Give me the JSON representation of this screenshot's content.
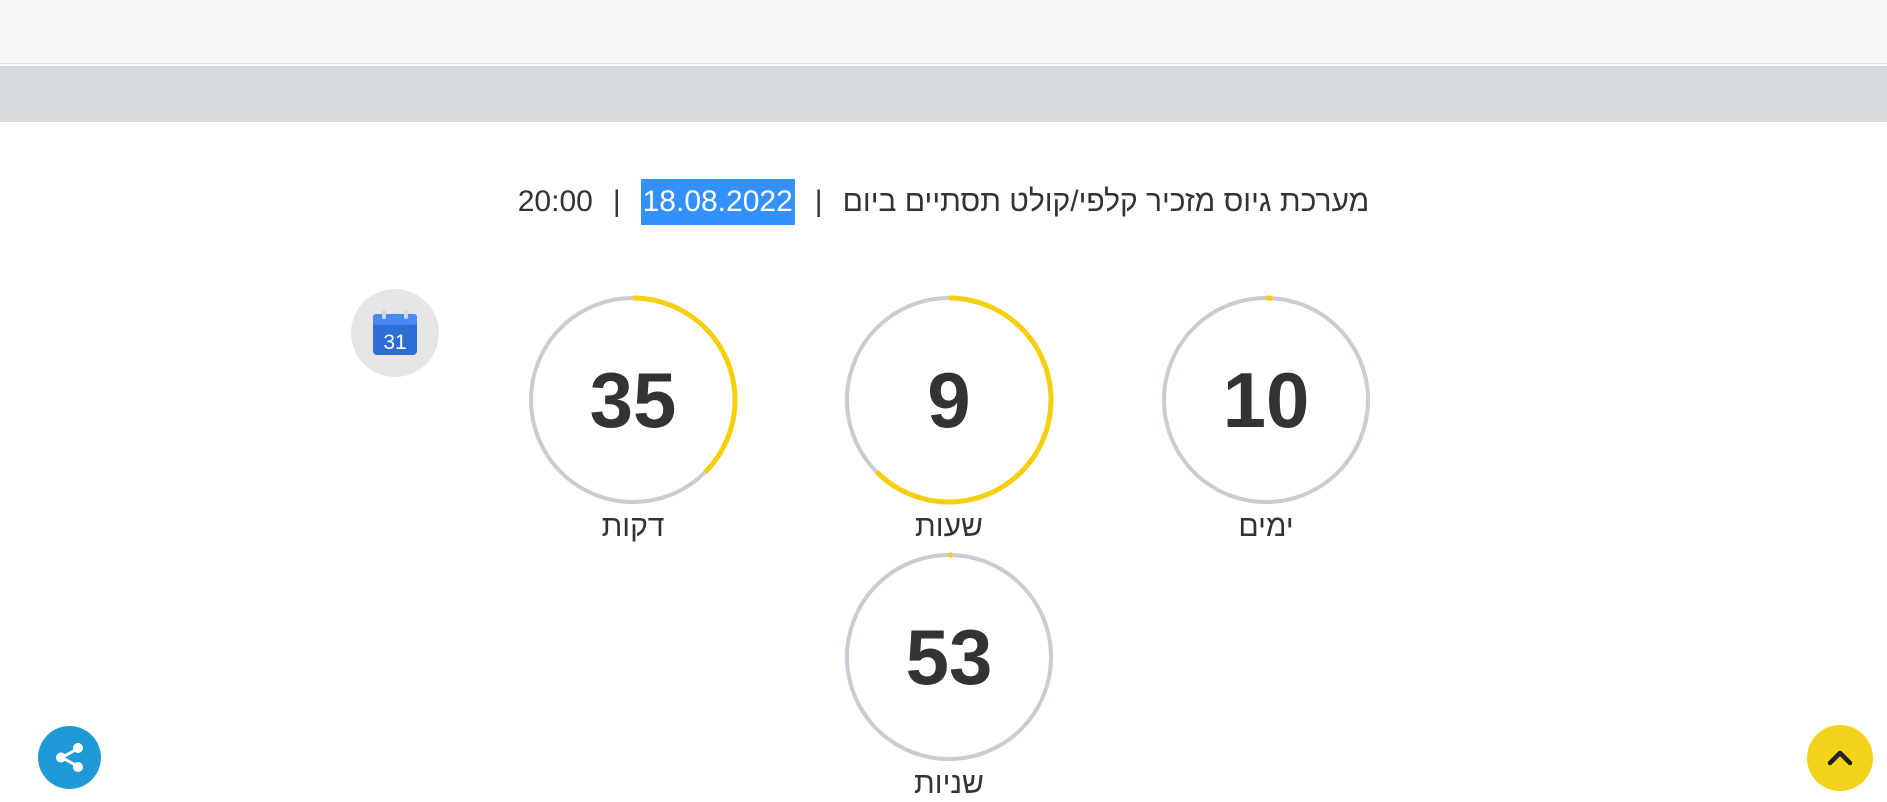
{
  "event": {
    "title": "מערכת גיוס מזכיר קלפי/קולט תסתיים ביום",
    "date": "18.08.2022",
    "time": "20:00",
    "separator": "|"
  },
  "countdown": {
    "days": {
      "value": "10",
      "label": "ימים",
      "fraction": 0.01
    },
    "hours": {
      "value": "9",
      "label": "שעות",
      "fraction": 0.625
    },
    "minutes": {
      "value": "35",
      "label": "דקות",
      "fraction": 0.375
    },
    "seconds": {
      "value": "53",
      "label": "שניות",
      "fraction": 0.005
    }
  },
  "calendar_icon_text": "31",
  "icons": {
    "calendar": "google-calendar-icon",
    "share": "share-icon",
    "scroll_top": "chevron-up-icon"
  },
  "colors": {
    "progress": "#f5cf0c",
    "track": "#c8ccd3",
    "share_button": "#1f9ad6",
    "top_button": "#f3d21a",
    "selection": "#3390ff"
  }
}
